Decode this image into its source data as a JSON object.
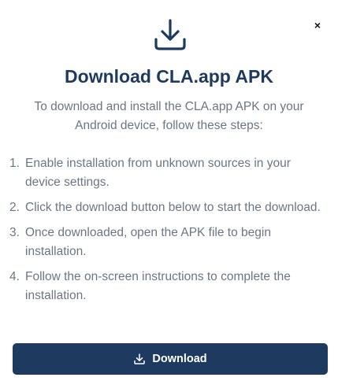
{
  "dialog": {
    "close_glyph": "×",
    "hero_icon": "download-icon",
    "title": "Download CLA.app APK",
    "subtitle": "To download and install the CLA.app APK on your Android device, follow these steps:",
    "steps": [
      {
        "num": "1.",
        "text": "Enable installation from unknown sources in your device settings."
      },
      {
        "num": "2.",
        "text": "Click the download button below to start the download."
      },
      {
        "num": "3.",
        "text": "Once downloaded, open the APK file to begin installation."
      },
      {
        "num": "4.",
        "text": "Follow the on-screen instructions to complete the installation."
      }
    ],
    "download_button": {
      "icon": "download-icon",
      "label": "Download"
    },
    "colors": {
      "primary": "#1f3a5f",
      "muted_text": "#6b7684",
      "background": "#ffffff"
    }
  }
}
